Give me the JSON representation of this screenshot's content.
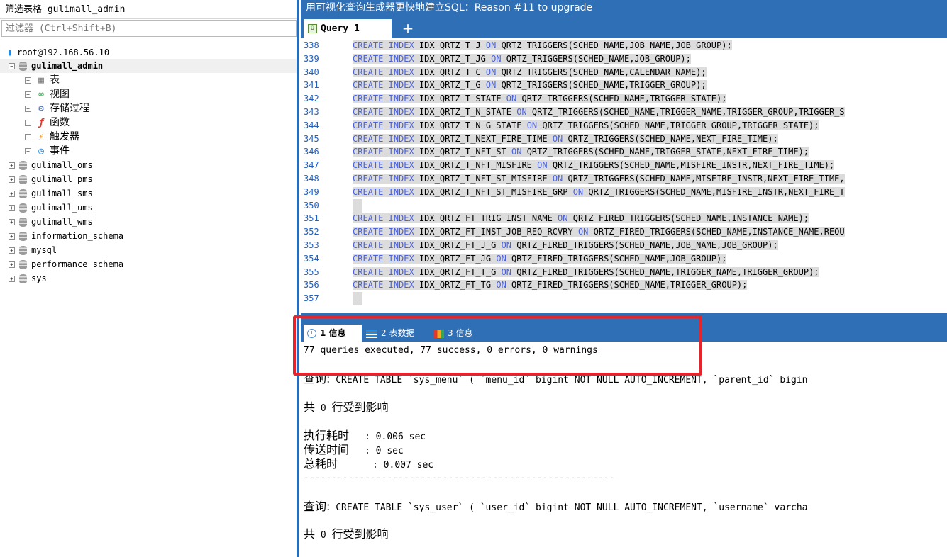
{
  "left": {
    "filter_title": "筛选表格 gulimall_admin",
    "filter_placeholder": "过滤器 (Ctrl+Shift+B)",
    "connection": "root@192.168.56.10",
    "active_db": "gulimall_admin",
    "categories": [
      "表",
      "视图",
      "存储过程",
      "函数",
      "触发器",
      "事件"
    ],
    "databases": [
      "gulimall_oms",
      "gulimall_pms",
      "gulimall_sms",
      "gulimall_ums",
      "gulimall_wms",
      "information_schema",
      "mysql",
      "performance_schema",
      "sys"
    ]
  },
  "title": "用可视化查询生成器更快地建立SQL：Reason #11 to upgrade",
  "tabs": {
    "query": "Query 1",
    "add": "+"
  },
  "editor": {
    "keywords": {
      "create": "CREATE",
      "index": "INDEX",
      "on": "ON"
    },
    "lines": [
      {
        "n": "338",
        "name": "IDX_QRTZ_T_J",
        "rest": "QRTZ_TRIGGERS(SCHED_NAME,JOB_NAME,JOB_GROUP);"
      },
      {
        "n": "339",
        "name": "IDX_QRTZ_T_JG",
        "rest": "QRTZ_TRIGGERS(SCHED_NAME,JOB_GROUP);"
      },
      {
        "n": "340",
        "name": "IDX_QRTZ_T_C",
        "rest": "QRTZ_TRIGGERS(SCHED_NAME,CALENDAR_NAME);"
      },
      {
        "n": "341",
        "name": "IDX_QRTZ_T_G",
        "rest": "QRTZ_TRIGGERS(SCHED_NAME,TRIGGER_GROUP);"
      },
      {
        "n": "342",
        "name": "IDX_QRTZ_T_STATE",
        "rest": "QRTZ_TRIGGERS(SCHED_NAME,TRIGGER_STATE);"
      },
      {
        "n": "343",
        "name": "IDX_QRTZ_T_N_STATE",
        "rest": "QRTZ_TRIGGERS(SCHED_NAME,TRIGGER_NAME,TRIGGER_GROUP,TRIGGER_S"
      },
      {
        "n": "344",
        "name": "IDX_QRTZ_T_N_G_STATE",
        "rest": "QRTZ_TRIGGERS(SCHED_NAME,TRIGGER_GROUP,TRIGGER_STATE);"
      },
      {
        "n": "345",
        "name": "IDX_QRTZ_T_NEXT_FIRE_TIME",
        "rest": "QRTZ_TRIGGERS(SCHED_NAME,NEXT_FIRE_TIME);"
      },
      {
        "n": "346",
        "name": "IDX_QRTZ_T_NFT_ST",
        "rest": "QRTZ_TRIGGERS(SCHED_NAME,TRIGGER_STATE,NEXT_FIRE_TIME);"
      },
      {
        "n": "347",
        "name": "IDX_QRTZ_T_NFT_MISFIRE",
        "rest": "QRTZ_TRIGGERS(SCHED_NAME,MISFIRE_INSTR,NEXT_FIRE_TIME);"
      },
      {
        "n": "348",
        "name": "IDX_QRTZ_T_NFT_ST_MISFIRE",
        "rest": "QRTZ_TRIGGERS(SCHED_NAME,MISFIRE_INSTR,NEXT_FIRE_TIME,"
      },
      {
        "n": "349",
        "name": "IDX_QRTZ_T_NFT_ST_MISFIRE_GRP",
        "rest": "QRTZ_TRIGGERS(SCHED_NAME,MISFIRE_INSTR,NEXT_FIRE_T"
      },
      {
        "n": "350",
        "name": "",
        "rest": ""
      },
      {
        "n": "351",
        "name": "IDX_QRTZ_FT_TRIG_INST_NAME",
        "rest": "QRTZ_FIRED_TRIGGERS(SCHED_NAME,INSTANCE_NAME);"
      },
      {
        "n": "352",
        "name": "IDX_QRTZ_FT_INST_JOB_REQ_RCVRY",
        "rest": "QRTZ_FIRED_TRIGGERS(SCHED_NAME,INSTANCE_NAME,REQU"
      },
      {
        "n": "353",
        "name": "IDX_QRTZ_FT_J_G",
        "rest": "QRTZ_FIRED_TRIGGERS(SCHED_NAME,JOB_NAME,JOB_GROUP);"
      },
      {
        "n": "354",
        "name": "IDX_QRTZ_FT_JG",
        "rest": "QRTZ_FIRED_TRIGGERS(SCHED_NAME,JOB_GROUP);"
      },
      {
        "n": "355",
        "name": "IDX_QRTZ_FT_T_G",
        "rest": "QRTZ_FIRED_TRIGGERS(SCHED_NAME,TRIGGER_NAME,TRIGGER_GROUP);"
      },
      {
        "n": "356",
        "name": "IDX_QRTZ_FT_TG",
        "rest": "QRTZ_FIRED_TRIGGERS(SCHED_NAME,TRIGGER_GROUP);"
      },
      {
        "n": "357",
        "name": "",
        "rest": ""
      }
    ]
  },
  "output_tabs": [
    {
      "num": "1",
      "label": "信息"
    },
    {
      "num": "2",
      "label": "表数据"
    },
    {
      "num": "3",
      "label": "信息"
    }
  ],
  "output": {
    "summary": "77 queries executed, 77 success, 0 errors, 0 warnings",
    "query_label": "查询:",
    "query1_sql": " CREATE TABLE `sys_menu` ( `menu_id` bigint NOT NULL AUTO_INCREMENT, `parent_id` bigin",
    "affected_prefix": "共",
    "affected_count": "0",
    "affected_suffix": "行受到影响",
    "exec_label": "执行耗时",
    "exec_value": ": 0.006 sec",
    "transfer_label": "传送时间",
    "transfer_value": ": 0 sec",
    "total_label": "总耗时",
    "total_value": ": 0.007 sec",
    "separator": "--------------------------------------------------------",
    "query2_sql": " CREATE TABLE `sys_user` ( `user_id` bigint NOT NULL AUTO_INCREMENT, `username` varcha",
    "affected2_prefix": "共",
    "affected2_count": "0",
    "affected2_suffix": "行受到影响"
  },
  "colors": {
    "accent_blue": "#2e6fb5",
    "highlight_red": "#e3262d",
    "keyword_blue": "#4a62e0",
    "selection_gray": "#dcdcdc"
  }
}
